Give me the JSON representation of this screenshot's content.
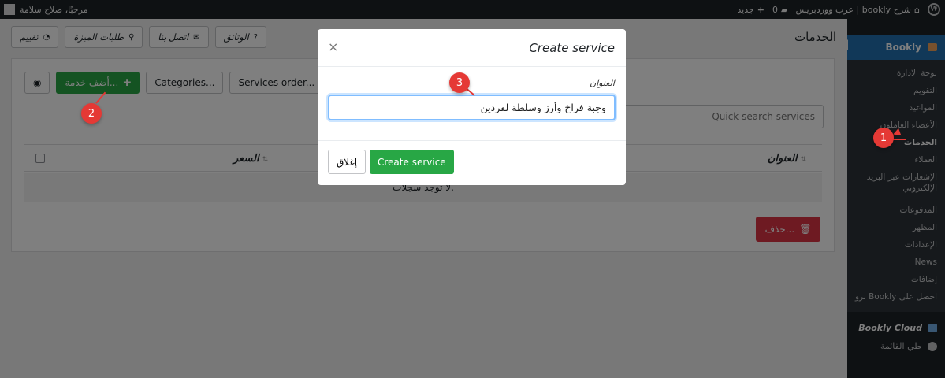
{
  "adminbar": {
    "site_name": "شرح bookly | عرب ووردبريس",
    "comments_count": "0",
    "new_label": "جديد",
    "greeting": "مرحبًا، صلاح سلامة"
  },
  "sidebar": {
    "bookly_label": "Bookly",
    "items": [
      "لوحة الادارة",
      "التقويم",
      "المواعيد",
      "الأعضاء العاملون",
      "الخدمات",
      "العملاء",
      "الإشعارات عبر البريد الإلكتروني",
      "المدفوعات",
      "المظهر",
      "الإعدادات",
      "News",
      "إضافات",
      "احصل على Bookly برو"
    ],
    "active_index": 4,
    "cloud_label": "Bookly Cloud",
    "collapse_label": "طي القائمة"
  },
  "main": {
    "page_title": "الخدمات",
    "top_buttons": [
      "الوثائق",
      "اتصل بنا",
      "طلبات الميزة",
      "تقييم"
    ],
    "toolbar": {
      "add_service": "أضف خدمة...",
      "categories": "Categories...",
      "services_order": "Services order..."
    },
    "search_placeholder": "Quick search services",
    "table": {
      "col_title": "العنوان",
      "col_price": "السعر",
      "empty": "لا توجد سجلات."
    },
    "delete_label": "حذف..."
  },
  "modal": {
    "title": "Create service",
    "close_symbol": "×",
    "field_label": "العنوان",
    "field_value": "وجبة فراخ وأرز وسلطة لفردين",
    "close_button": "إغلاق",
    "create_button": "Create service"
  },
  "callouts": [
    "1",
    "2",
    "3"
  ],
  "colors": {
    "accent": "#2271b1",
    "green": "#28a745",
    "red": "#dc3545",
    "callout": "#e53935"
  }
}
